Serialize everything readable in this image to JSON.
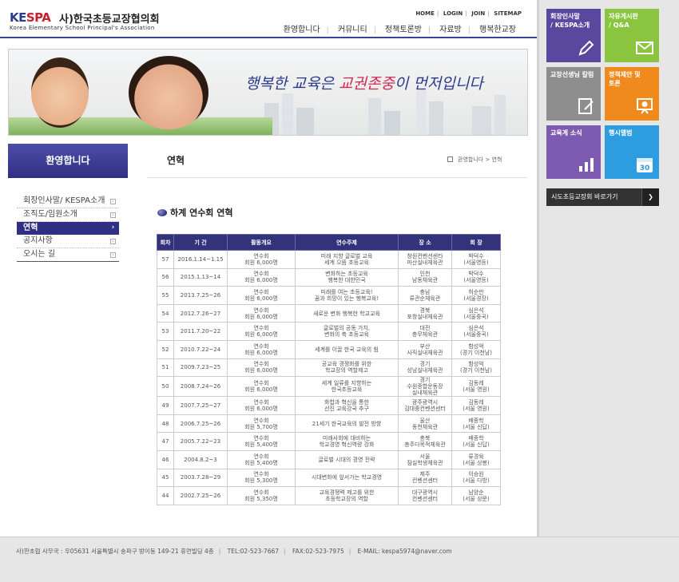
{
  "header": {
    "logo_ke": "KE",
    "logo_spa": "SPA",
    "logo_name": "사)한국초등교장협의회",
    "logo_sub": "Korea Elementary School Principal's Association",
    "util_links": [
      "HOME",
      "LOGIN",
      "JOIN",
      "SITEMAP"
    ],
    "gnb": [
      "환영합니다",
      "커뮤니티",
      "정책토론방",
      "자료방",
      "행복한교장"
    ]
  },
  "banner": {
    "slogan_a": "행복한 교육은 ",
    "slogan_b": "교권존중",
    "slogan_c": "이 먼저입니다"
  },
  "lnb": {
    "title": "환영합니다",
    "items": [
      {
        "label": "회장인사말/ KESPA소개",
        "active": false
      },
      {
        "label": "조직도/임원소개",
        "active": false
      },
      {
        "label": "연혁",
        "active": true
      },
      {
        "label": "공지사항",
        "active": false
      },
      {
        "label": "오시는 길",
        "active": false
      }
    ]
  },
  "content": {
    "title": "연혁",
    "breadcrumb": "환영합니다 > 연혁",
    "sub_title": "하계 연수회 연혁"
  },
  "table": {
    "headers": [
      "회차",
      "기 간",
      "활동개요",
      "연수주제",
      "장 소",
      "회 장"
    ],
    "rows": [
      [
        "57",
        "2016.1.14~1.15",
        "연수회\n회원 6,000명",
        "미래 지향 글로벌 교육\n세계 으뜸 초등교육",
        "창원컨벤션센타\n마산실내체육관",
        "박덕수\n(서울영등)"
      ],
      [
        "56",
        "2015.1.13~14",
        "연수회\n회원 6,000명",
        "변화하는 초등교육\n행복한 대한민국",
        "인천\n남동체육관",
        "박덕수\n(서울영등)"
      ],
      [
        "55",
        "2013.7.25~26",
        "연수회\n회원 6,000명",
        "미래를 여는 초등교육!\n꿈과 희망이 있는 행복교육!",
        "충남\n류관순체육관",
        "허순만\n(서울경장)"
      ],
      [
        "54",
        "2012.7.26~27",
        "연수회\n회원 6,000명",
        "새로운 변화 행복한 학교교육",
        "경북\n포항실내체육관",
        "심은석\n(서울중곡)"
      ],
      [
        "53",
        "2011.7.20~22",
        "연수회\n회원 6,000명",
        "글로벌의 공동 가치,\n변화의 축 초등교육",
        "대전\n충무체육관",
        "심은석\n(서울중곡)"
      ],
      [
        "52",
        "2010.7.22~24",
        "연수회\n회원 6,000명",
        "세계를 이끌 한국 교육의 힘",
        "부산\n사직실내체육관",
        "함성억\n(경기 이천남)"
      ],
      [
        "51",
        "2009.7.23~25",
        "연수회\n회원 6,000명",
        "공교육 경쟁화를 위한\n학교장의 역할제고",
        "경기\n성남실내체육관",
        "함성억\n(경기 이천남)"
      ],
      [
        "50",
        "2008.7.24~26",
        "연수회\n회원 6,000명",
        "세계 일류를 지향하는\n한국초등교육",
        "경기\n수원종합운동장\n실내체육관",
        "김동레\n(서울 영원)"
      ],
      [
        "49",
        "2007.7.25~27",
        "연수회\n회원 6,000명",
        "화합과 혁신을 통한\n선진 교육강국 추구",
        "광주광역시\n김대중컨벤션센터",
        "김동레\n(서울 영원)"
      ],
      [
        "48",
        "2006.7.25~26",
        "연수회\n회원 5,700명",
        "21세기 한국교육의 발전 방향",
        "울산\n동천체육관",
        "배종학\n(서울 신답)"
      ],
      [
        "47",
        "2005.7.22~23",
        "연수회\n회원 5,400명",
        "미래사회에 대비하는\n학교경영 혁신역량 강화",
        "충북\n충주다목적체육관",
        "배종학\n(서울 신답)"
      ],
      [
        "46",
        "2004.8.2~3",
        "연수회\n회원 5,400명",
        "글로벌 시대의 경영 전략",
        "서울\n잠실학생체육관",
        "류경육\n(서울 상봉)"
      ],
      [
        "45",
        "2003.7.28~29",
        "연수회\n회원 5,300명",
        "시대변화에 앞서가는 학교경영",
        "제주\n컨벤션센터",
        "이승원\n(서울 다방)"
      ],
      [
        "44",
        "2002.7.25~26",
        "연수회\n회원 5,350명",
        "교육경쟁력 제고를 위한\n초등학교장의 역할",
        "대구광역시\n컨벤션센터",
        "남양순\n(서울 상문)"
      ]
    ]
  },
  "tiles": [
    {
      "label": "회장인사말\n/ KESPA소개",
      "icon": "pencil-icon"
    },
    {
      "label": "자유게시판\n/ Q&A",
      "icon": "mail-icon"
    },
    {
      "label": "교장선생님 칼럼",
      "icon": "note-icon"
    },
    {
      "label": "정책제안 및\n토론",
      "icon": "chart-board-icon"
    },
    {
      "label": "교육계 소식",
      "icon": "bar-chart-icon"
    },
    {
      "label": "행시앨범",
      "icon": "calendar-icon",
      "calendar_day": "30"
    }
  ],
  "region": {
    "label": "시도초등교장회 바로가기",
    "toggle": "❯"
  },
  "footer": {
    "address": "사)한초협 사무국 : 우05631 서울특별시 송파구 방이동 149-21 휴먼빌딩 4층",
    "tel": "TEL:02-523-7667",
    "fax": "FAX:02-523-7975",
    "email": "E-MAIL: kespa5974@naver.com"
  },
  "colors": {
    "primary": "#2f2f84",
    "table_header": "#33337c",
    "accent_red": "#c8202c"
  }
}
